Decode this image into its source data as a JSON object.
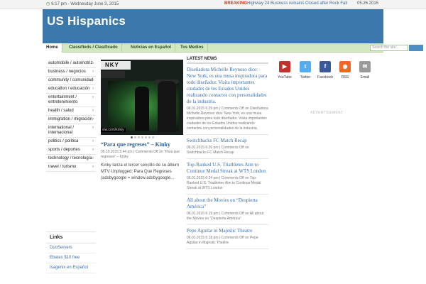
{
  "topbar": {
    "datetime": "6:17 pm - Wednesday June 3, 2015",
    "breaking_label": "BREAKING:",
    "headline": "Highway 24 Business remains Closed after Rock Fall",
    "headline_date": "05.26.2015"
  },
  "site": {
    "title": "US Hispanics"
  },
  "nav": {
    "items": [
      "Home",
      "Classifieds / Clasificado",
      "Noticias en Español",
      "Tus Medios"
    ],
    "search_placeholder": "Search the site..."
  },
  "sidebar": {
    "categories": [
      "automobile / automotriz",
      "business / negocios",
      "community / comunidad",
      "education / educación",
      "entertainment / entretenimiento",
      "health / salud",
      "immigration / migración",
      "international / internacional",
      "politics / política",
      "sports / deportes",
      "technology / tecnología",
      "travel / turismo"
    ],
    "links_title": "Links",
    "links": [
      "DuoServers",
      "Ebates $10 free",
      "Isagenix en Español"
    ]
  },
  "featured": {
    "image_sign": "NKY",
    "image_url": "ww.com/kinky",
    "title": "“Para que regreses” – Kinky",
    "meta": "05.19.2015 5:44 pm | Comments Off on “Para que regreses” – Kinky",
    "excerpt": "Kinky lanza el tercer sencillo de su álbum MTV Unplugged: Para Que Regreses (adsbygoogle = window.adsbygoogle..."
  },
  "latest": {
    "title": "LATEST NEWS",
    "items": [
      {
        "title": "Diseñadora Michelle Reynoso dice: New York, es una musa inspiradora para todo diseñador. Visita importantes ciudades de los Estados Unidos realizando contactos con personalidades de la industria.",
        "meta": "06.01.2015 6:29 pm | Comments Off on Diseñadora Michelle Reynoso dice: New York, es una musa inspiradora para todo diseñador. Visita importantes ciudades de los Estados Unidos realizando contactos con personalidades de la industria."
      },
      {
        "title": "Switchbacks FC Match Recap",
        "meta": "06.01.2015 6:26 pm | Comments Off on Switchbacks FC Match Recap"
      },
      {
        "title": "Top-Ranked U.S. Triathletes Aim to Continue Medal Streak at WTS London",
        "meta": "06.01.2015 6:24 pm | Comments Off on Top-Ranked U.S. Triathletes Aim to Continue Medal Streak at WTS London"
      },
      {
        "title": "All about the Movies on “Despierta América”",
        "meta": "06.01.2015 6:19 pm | Comments Off on All about the Movies on “Despierta América”"
      },
      {
        "title": "Pepe Aguilar in Majestic Theatre",
        "meta": "06.01.2015 6:18 pm | Comments Off on Pepe Aguilar in Majestic Theatre"
      }
    ]
  },
  "social": {
    "items": [
      {
        "label": "YouTube",
        "icon": "youtube-icon",
        "color": "#c4302b"
      },
      {
        "label": "Twitter",
        "icon": "twitter-icon",
        "color": "#55acee"
      },
      {
        "label": "Facebook",
        "icon": "facebook-icon",
        "color": "#3b5998"
      },
      {
        "label": "RSS",
        "icon": "rss-icon",
        "color": "#f26522"
      },
      {
        "label": "Email",
        "icon": "email-icon",
        "color": "#9a9a9a"
      }
    ],
    "advert_label": "ADVERTISEMENT"
  },
  "colors": {
    "header": "#3b79ac",
    "nav": "#d3e8c2",
    "link": "#3a6ea5",
    "breaking": "#c8391b"
  }
}
